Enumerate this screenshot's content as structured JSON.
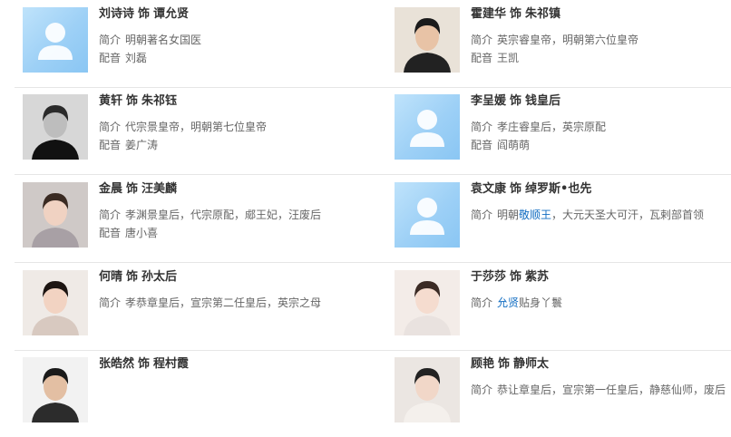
{
  "labels": {
    "intro": "简介",
    "voice": "配音",
    "plays": "饰"
  },
  "rows": [
    {
      "left": {
        "actor": "刘诗诗",
        "role": "谭允贤",
        "photo": "placeholder-avatar",
        "intro_parts": [
          {
            "t": "明朝著名女国医"
          }
        ],
        "voice": "刘磊"
      },
      "right": {
        "actor": "霍建华",
        "role": "朱祁镇",
        "photo": "actor-photo-man-suit",
        "intro_parts": [
          {
            "t": "英宗睿皇帝，明朝第六位皇帝"
          }
        ],
        "voice": "王凯"
      }
    },
    {
      "left": {
        "actor": "黄轩",
        "role": "朱祁钰",
        "photo": "actor-photo-man-bw",
        "intro_parts": [
          {
            "t": "代宗景皇帝，明朝第七位皇帝"
          }
        ],
        "voice": "姜广涛"
      },
      "right": {
        "actor": "李呈媛",
        "role": "钱皇后",
        "photo": "placeholder-avatar",
        "intro_parts": [
          {
            "t": "孝庄睿皇后，英宗原配"
          }
        ],
        "voice": "阎萌萌"
      }
    },
    {
      "left": {
        "actor": "金晨",
        "role": "汪美麟",
        "photo": "actor-photo-woman",
        "intro_parts": [
          {
            "t": "孝渊景皇后，代宗原配，郕王妃，汪废后"
          }
        ],
        "voice": "唐小喜"
      },
      "right": {
        "actor": "袁文康",
        "role": "绰罗斯•也先",
        "photo": "placeholder-avatar",
        "intro_parts": [
          {
            "t": "明朝"
          },
          {
            "t": "敬顺王",
            "link": true
          },
          {
            "t": "，大元天圣大可汗，瓦剌部首领"
          }
        ],
        "voice": ""
      }
    },
    {
      "left": {
        "actor": "何晴",
        "role": "孙太后",
        "photo": "actor-photo-woman-older",
        "intro_parts": [
          {
            "t": "孝恭章皇后，宣宗第二任皇后，英宗之母"
          }
        ],
        "voice": ""
      },
      "right": {
        "actor": "于莎莎",
        "role": "紫苏",
        "photo": "actor-photo-woman-young",
        "intro_parts": [
          {
            "t": "允贤",
            "link": true
          },
          {
            "t": "贴身丫鬟"
          }
        ],
        "voice": ""
      }
    },
    {
      "left": {
        "actor": "张皓然",
        "role": "程村霞",
        "photo": "actor-photo-man-young",
        "intro_parts": [],
        "voice": ""
      },
      "right": {
        "actor": "顾艳",
        "role": "静师太",
        "photo": "actor-photo-woman-nun",
        "intro_parts": [
          {
            "t": "恭让章皇后，宣宗第一任皇后，静慈仙师，废后"
          }
        ],
        "voice": ""
      }
    }
  ]
}
